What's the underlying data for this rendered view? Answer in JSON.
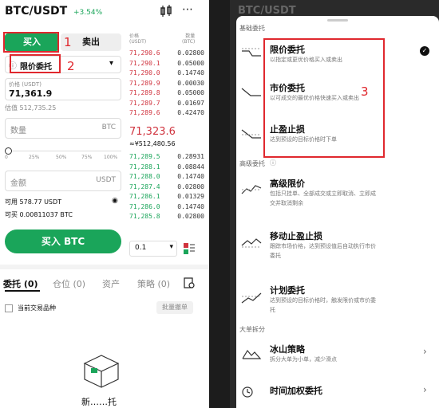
{
  "left": {
    "pair": "BTC/USDT",
    "change": "+3.54%",
    "buy_tab": "买入",
    "sell_tab": "卖出",
    "order_type": "限价委托",
    "price_label": "价格 (USDT)",
    "price_value": "71,361.9",
    "estimate": "估值 512,735.25",
    "qty_placeholder": "数量",
    "qty_unit": "BTC",
    "slider_marks": [
      "0",
      "25%",
      "50%",
      "75%",
      "100%"
    ],
    "amount_placeholder": "金额",
    "amount_unit": "USDT",
    "available": "可用 578.77 USDT",
    "can_buy": "可买 0.00811037 BTC",
    "buy_button": "买入 BTC",
    "ob_header_price": "价格\n(USDT)",
    "ob_header_qty": "数量\n(BTC)",
    "asks": [
      {
        "p": "71,290.6",
        "q": "0.02800"
      },
      {
        "p": "71,290.1",
        "q": "0.05000"
      },
      {
        "p": "71,290.0",
        "q": "0.14740"
      },
      {
        "p": "71,289.9",
        "q": "0.00030"
      },
      {
        "p": "71,289.8",
        "q": "0.05000"
      },
      {
        "p": "71,289.7",
        "q": "0.01697"
      },
      {
        "p": "71,289.6",
        "q": "0.42470"
      }
    ],
    "last_price": "71,323.6",
    "last_price_fiat": "≈¥512,480.56",
    "bids": [
      {
        "p": "71,289.5",
        "q": "0.28931"
      },
      {
        "p": "71,288.1",
        "q": "0.08844"
      },
      {
        "p": "71,288.0",
        "q": "0.14740"
      },
      {
        "p": "71,287.4",
        "q": "0.02800"
      },
      {
        "p": "71,286.1",
        "q": "0.01329"
      },
      {
        "p": "71,286.0",
        "q": "0.14740"
      },
      {
        "p": "71,285.8",
        "q": "0.02800"
      }
    ],
    "depth_select": "0.1",
    "tabs": [
      "委托 (0)",
      "仓位 (0)",
      "资产",
      "策略 (0)"
    ],
    "current_pair_only": "当前交易品种",
    "cancel_all": "批量撤单",
    "empty_text": "新……托",
    "annotations": [
      "1",
      "2"
    ]
  },
  "right": {
    "pair": "BTC/USDT",
    "basic_section": "基础委托",
    "basic_options": [
      {
        "title": "限价委托",
        "desc": "以指定或更优价格买入或卖出"
      },
      {
        "title": "市价委托",
        "desc": "以可成交的最优价格快速买入或卖出"
      },
      {
        "title": "止盈止损",
        "desc": "达到预设的目标价格时下单"
      }
    ],
    "annotation": "3",
    "advanced_section": "高级委托",
    "advanced_options": [
      {
        "title": "高级限价",
        "desc1": "包括只挂单、全部成交或立即取消、立即成",
        "desc2": "交并取消剩余"
      },
      {
        "title": "移动止盈止损",
        "desc1": "跟踪市场价格，达到预设值后自动执行市价",
        "desc2": "委托"
      },
      {
        "title": "计划委托",
        "desc1": "达到预设的目标价格时，触发限价或市价委",
        "desc2": "托"
      }
    ],
    "split_section": "大单拆分",
    "split_options": [
      {
        "title": "冰山策略",
        "desc": "拆分大单为小单，减少滑点"
      },
      {
        "title": "时间加权委托",
        "desc": ""
      }
    ]
  }
}
